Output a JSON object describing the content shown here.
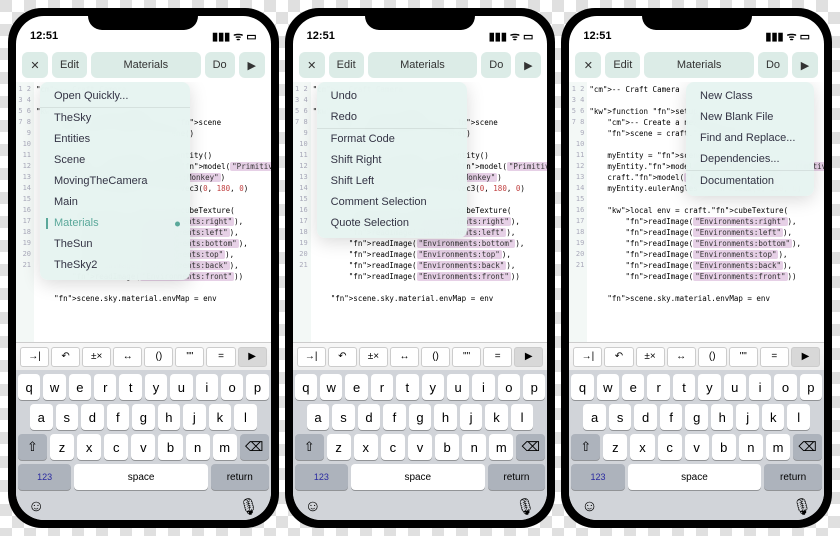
{
  "statusbar": {
    "time": "12:51"
  },
  "toolbar": {
    "close": "✕",
    "edit": "Edit",
    "title": "Materials",
    "do": "Do",
    "play": "▶"
  },
  "phones": [
    {
      "popup_side": "left",
      "popup": [
        {
          "label": "Open Quickly...",
          "sep": false,
          "active": false
        },
        {
          "label": "TheSky",
          "sep": true,
          "active": false
        },
        {
          "label": "Entities",
          "sep": false,
          "active": false
        },
        {
          "label": "Scene",
          "sep": false,
          "active": false
        },
        {
          "label": "MovingTheCamera",
          "sep": false,
          "active": false
        },
        {
          "label": "Main",
          "sep": false,
          "active": false
        },
        {
          "label": "Materials",
          "sep": false,
          "active": true
        },
        {
          "label": "TheSun",
          "sep": false,
          "active": false
        },
        {
          "label": "TheSky2",
          "sep": false,
          "active": false
        }
      ]
    },
    {
      "popup_side": "left",
      "popup": [
        {
          "label": "Undo",
          "sep": false
        },
        {
          "label": "Redo",
          "sep": false
        },
        {
          "label": "Format Code",
          "sep": true
        },
        {
          "label": "Shift Right",
          "sep": false
        },
        {
          "label": "Shift Left",
          "sep": false
        },
        {
          "label": "Comment Selection",
          "sep": false
        },
        {
          "label": "Quote Selection",
          "sep": false
        }
      ]
    },
    {
      "popup_side": "right",
      "popup": [
        {
          "label": "New Class",
          "sep": false
        },
        {
          "label": "New Blank File",
          "sep": false
        },
        {
          "label": "Find and Replace...",
          "sep": false
        },
        {
          "label": "Dependencies...",
          "sep": false
        },
        {
          "label": "Documentation",
          "sep": true
        }
      ]
    }
  ],
  "code": {
    "gutter_start": 1,
    "gutter_end": 21,
    "comment": "-- Craft Camera",
    "lines": [
      "-- Craft Camera",
      "",
      "function setup()",
      "    -- Create a new craft scene",
      "    scene = craft.scene()",
      "",
      "    myEntity = scene:entity()",
      "    myEntity.model = craft.model(\"Primitives:Monkey\")",
      "    craft.model(\"Primitives:Monkey\")",
      "    myEntity.eulerAngles = vec3(0, 180, 0)",
      "",
      "    local env = craft.cubeTexture(",
      "        readImage(\"Environments:right\"),",
      "        readImage(\"Environments:left\"),",
      "        readImage(\"Environments:bottom\"),",
      "        readImage(\"Environments:top\"),",
      "        readImage(\"Environments:back\"),",
      "        readImage(\"Environments:front\"))",
      "",
      "    scene.sky.material.envMap = env",
      ""
    ]
  },
  "accessory": [
    "→|",
    "↶",
    "±×",
    "↔",
    "()",
    "\"\"",
    "=",
    "▶"
  ],
  "keyboard": {
    "row1": [
      "q",
      "w",
      "e",
      "r",
      "t",
      "y",
      "u",
      "i",
      "o",
      "p"
    ],
    "row2": [
      "a",
      "s",
      "d",
      "f",
      "g",
      "h",
      "j",
      "k",
      "l"
    ],
    "row3": [
      "z",
      "x",
      "c",
      "v",
      "b",
      "n",
      "m"
    ],
    "shift": "⇧",
    "del": "⌫",
    "num": "123",
    "space": "space",
    "return": "return",
    "emoji": "😀",
    "mic": "🎤"
  }
}
